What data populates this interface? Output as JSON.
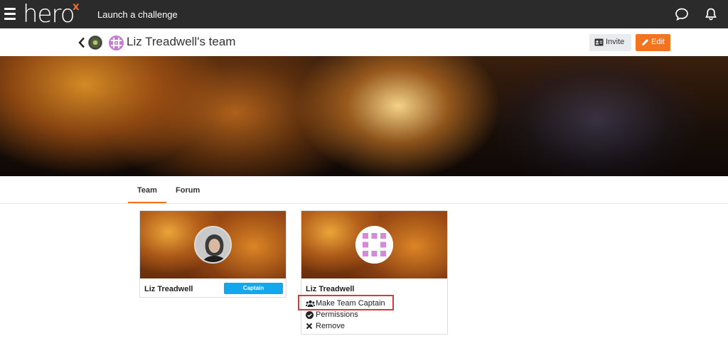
{
  "nav": {
    "logo_text": "hero",
    "logo_accent": "x",
    "launch_label": "Launch a challenge",
    "icons": [
      "menu-icon",
      "chat-icon",
      "bell-icon"
    ]
  },
  "team": {
    "name": "Liz Treadwell's team",
    "invite_label": "Invite",
    "edit_label": "Edit"
  },
  "tabs": [
    {
      "label": "Team",
      "active": true
    },
    {
      "label": "Forum",
      "active": false
    }
  ],
  "members": [
    {
      "name": "Liz Treadwell",
      "badge": "Captain"
    },
    {
      "name": "Liz Treadwell",
      "actions": [
        "Make Team Captain",
        "Permissions",
        "Remove"
      ]
    }
  ],
  "colors": {
    "accent": "#f47321",
    "captain": "#11a8ee",
    "highlight": "#d43a3a",
    "topbar": "#2b2b2b"
  }
}
